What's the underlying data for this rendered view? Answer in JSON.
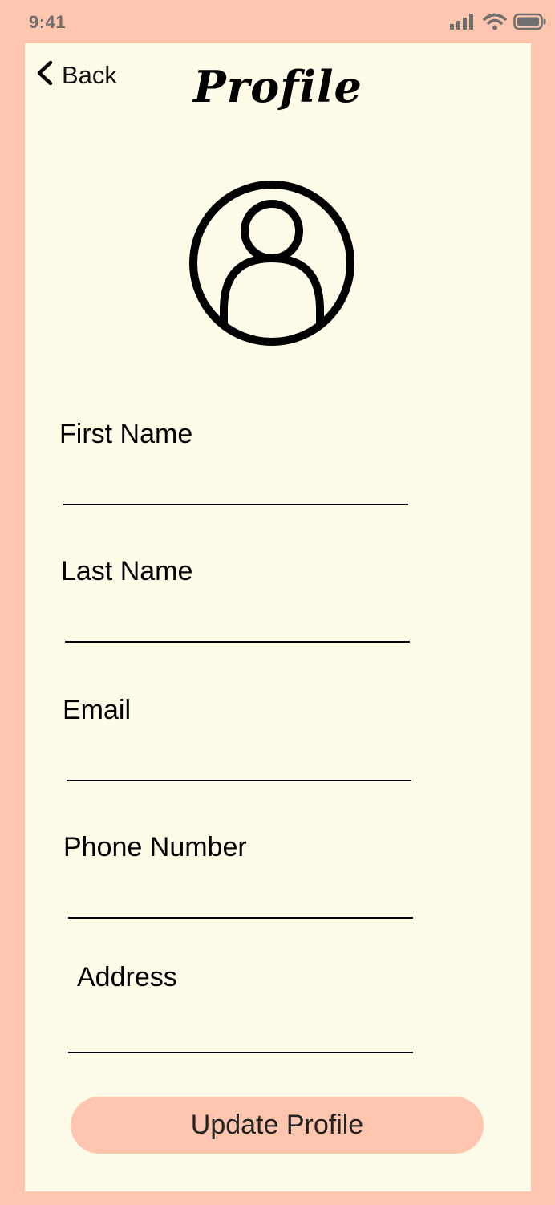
{
  "status_bar": {
    "time": "9:41",
    "icons": [
      "signal-icon",
      "wifi-icon",
      "battery-icon"
    ]
  },
  "header": {
    "back_label": "Back",
    "title": "Profile"
  },
  "avatar": {
    "icon": "user-circle-icon"
  },
  "form": {
    "fields": [
      {
        "label": "First Name",
        "value": ""
      },
      {
        "label": "Last Name",
        "value": ""
      },
      {
        "label": "Email",
        "value": ""
      },
      {
        "label": "Phone Number",
        "value": ""
      },
      {
        "label": "Address",
        "value": ""
      }
    ],
    "submit_label": "Update Profile"
  },
  "colors": {
    "frame": "#fec5af",
    "screen_background": "#fefce8",
    "button": "#fec5af",
    "text": "#000000"
  }
}
